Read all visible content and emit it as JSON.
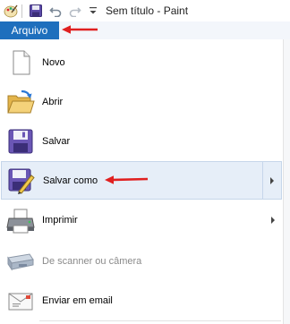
{
  "window": {
    "title": "Sem título - Paint"
  },
  "ribbon": {
    "file_tab": "Arquivo"
  },
  "menu": {
    "items": [
      {
        "label": "Novo",
        "icon": "new-file-icon",
        "has_submenu": false,
        "enabled": true
      },
      {
        "label": "Abrir",
        "icon": "open-folder-icon",
        "has_submenu": false,
        "enabled": true
      },
      {
        "label": "Salvar",
        "icon": "save-icon",
        "has_submenu": false,
        "enabled": true
      },
      {
        "label": "Salvar como",
        "icon": "save-as-icon",
        "has_submenu": true,
        "enabled": true,
        "selected": true
      },
      {
        "label": "Imprimir",
        "icon": "printer-icon",
        "has_submenu": true,
        "enabled": true
      },
      {
        "label": "De scanner ou câmera",
        "icon": "scanner-icon",
        "has_submenu": false,
        "enabled": false
      },
      {
        "label": "Enviar em email",
        "icon": "email-icon",
        "has_submenu": false,
        "enabled": true
      }
    ]
  },
  "colors": {
    "file_tab": "#1e6fbd",
    "selected_bg": "#e6eef8",
    "annotation_arrow": "#e02020"
  }
}
